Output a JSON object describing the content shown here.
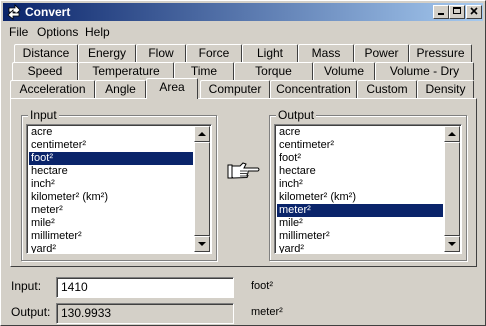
{
  "window": {
    "title": "Convert"
  },
  "menu": [
    "File",
    "Options",
    "Help"
  ],
  "tabs": {
    "row1": [
      "Distance",
      "Energy",
      "Flow",
      "Force",
      "Light",
      "Mass",
      "Power",
      "Pressure"
    ],
    "row2": [
      "Speed",
      "Temperature",
      "Time",
      "Torque",
      "Volume",
      "Volume - Dry"
    ],
    "row3": [
      "Acceleration",
      "Angle",
      "Area",
      "Computer",
      "Concentration",
      "Custom",
      "Density"
    ],
    "active": "Area"
  },
  "input_group": {
    "label": "Input",
    "items": [
      "acre",
      "centimeter²",
      "foot²",
      "hectare",
      "inch²",
      "kilometer² (km²)",
      "meter²",
      "mile²",
      "millimeter²",
      "yard²"
    ],
    "selected": "foot²"
  },
  "output_group": {
    "label": "Output",
    "items": [
      "acre",
      "centimeter²",
      "foot²",
      "hectare",
      "inch²",
      "kilometer² (km²)",
      "meter²",
      "mile²",
      "millimeter²",
      "yard²"
    ],
    "selected": "meter²"
  },
  "arrow_icon": "pointing-hand-icon",
  "fields": {
    "input_label": "Input:",
    "input_value": "1410",
    "input_unit": "foot²",
    "output_label": "Output:",
    "output_value": "130.9933",
    "output_unit": "meter²"
  },
  "colors": {
    "selection": "#0a246a",
    "titlebar_start": "#0a246a",
    "titlebar_end": "#a6caf0",
    "face": "#d4d0c8"
  }
}
